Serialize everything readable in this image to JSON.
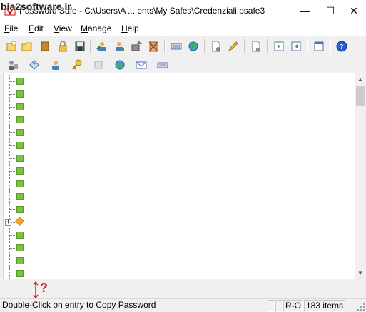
{
  "watermark": "bia2software.ir",
  "window": {
    "title": "Password Safe - C:\\Users\\A ... ents\\My Safes\\Credenziali.psafe3",
    "minimize": "—",
    "maximize": "☐",
    "close": "✕"
  },
  "menu": [
    {
      "label": "File",
      "accel": "F",
      "rest": "ile"
    },
    {
      "label": "Edit",
      "accel": "E",
      "rest": "dit"
    },
    {
      "label": "View",
      "accel": "V",
      "rest": "iew"
    },
    {
      "label": "Manage",
      "accel": "M",
      "rest": "anage"
    },
    {
      "label": "Help",
      "accel": "H",
      "rest": "elp"
    }
  ],
  "toolbar1": [
    "new-database-icon",
    "open-database-icon",
    "close-database-icon",
    "lock-database-icon",
    "save-database-icon",
    "copy-username-icon",
    "copy-password-icon",
    "autotype-icon",
    "clear-clipboard-icon",
    "add-entry-icon",
    "browse-url-icon",
    "add-group-icon",
    "edit-entry-icon",
    "delete-entry-icon",
    "expand-all-icon",
    "collapse-all-icon",
    "options-icon",
    "help-icon"
  ],
  "toolbar2": [
    "user-password-icon",
    "notes-icon",
    "username-icon",
    "password-key-icon",
    "blank-icon",
    "browse-icon",
    "email-icon",
    "keyboard-icon"
  ],
  "tree": {
    "rows": 16,
    "expandable_row": 11,
    "expander_symbol": "+"
  },
  "scrollbar": {
    "up": "▲",
    "down": "▼"
  },
  "help_hint": {
    "symbol": "?"
  },
  "status": {
    "message": "Double-Click on entry to Copy Password",
    "mode": "R-O",
    "count": "183 items"
  },
  "colors": {
    "entry_node": "#7cc242",
    "group_node": "#f5a623",
    "help_accent": "#e02020"
  }
}
